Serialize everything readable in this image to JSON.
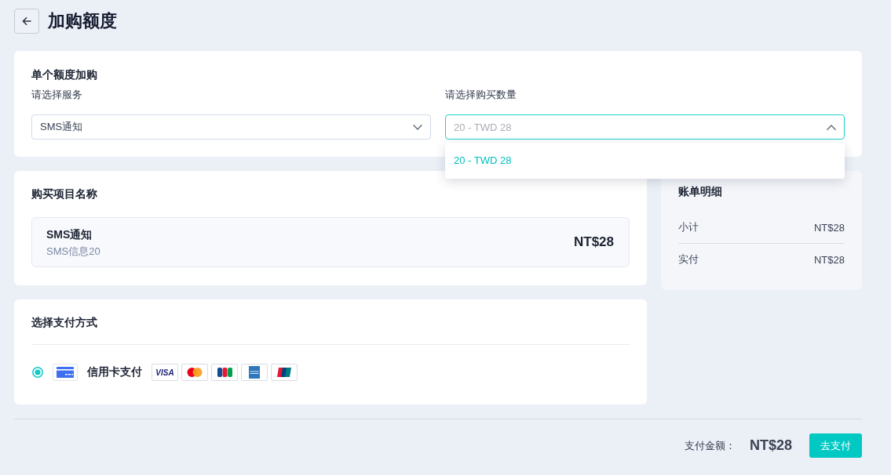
{
  "header": {
    "title": "加购额度"
  },
  "purchase": {
    "title": "单个额度加购",
    "fields": [
      {
        "label": "请选择服务",
        "value": "SMS通知",
        "expanded": false
      },
      {
        "label": "请选择购买数量",
        "placeholder": "20 - TWD 28",
        "expanded": true,
        "options": [
          {
            "label": "20 - TWD 28",
            "selected": true
          }
        ]
      }
    ]
  },
  "item_section": {
    "title": "购买项目名称",
    "item": {
      "name": "SMS通知",
      "detail": "SMS信息20",
      "price": "NT$28"
    }
  },
  "billing": {
    "title": "账单明细",
    "rows": [
      {
        "label": "小计",
        "value": "NT$28"
      },
      {
        "label": "实付",
        "value": "NT$28"
      }
    ]
  },
  "payment": {
    "title": "选择支付方式",
    "methods": [
      {
        "label": "信用卡支付",
        "selected": true,
        "brands": [
          {
            "kind": "visa",
            "label": "VISA"
          },
          {
            "kind": "mastercard"
          },
          {
            "kind": "jcb"
          },
          {
            "kind": "amex"
          },
          {
            "kind": "unionpay"
          }
        ]
      }
    ]
  },
  "footer": {
    "total_label": "支付金额：",
    "total": "NT$28",
    "pay_button": "去支付"
  }
}
